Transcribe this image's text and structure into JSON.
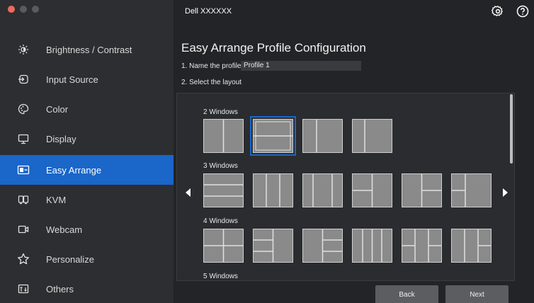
{
  "window": {
    "title": "Dell XXXXXX"
  },
  "sidebar": {
    "items": [
      {
        "label": "Brightness / Contrast",
        "icon": "brightness-icon",
        "active": false
      },
      {
        "label": "Input Source",
        "icon": "input-source-icon",
        "active": false
      },
      {
        "label": "Color",
        "icon": "color-palette-icon",
        "active": false
      },
      {
        "label": "Display",
        "icon": "display-icon",
        "active": false
      },
      {
        "label": "Easy Arrange",
        "icon": "easy-arrange-icon",
        "active": true
      },
      {
        "label": "KVM",
        "icon": "kvm-icon",
        "active": false
      },
      {
        "label": "Webcam",
        "icon": "webcam-icon",
        "active": false
      },
      {
        "label": "Personalize",
        "icon": "star-icon",
        "active": false
      },
      {
        "label": "Others",
        "icon": "others-icon",
        "active": false
      }
    ]
  },
  "main": {
    "page_title": "Easy Arrange Profile Configuration",
    "step1_label": "1. Name the profile",
    "profile_name": "Profile 1",
    "step2_label": "2. Select the layout",
    "groups": [
      {
        "label": "2 Windows",
        "layouts": [
          "2-vertical",
          "2-horizontal",
          "2-left-narrow",
          "2-left-narrow-b"
        ],
        "selected_index": 1
      },
      {
        "label": "3 Windows",
        "layouts": [
          "3-rows",
          "3-cols",
          "3-cols-wide-center",
          "3-left-split",
          "3-right-split",
          "3-left-split-b"
        ],
        "selected_index": -1
      },
      {
        "label": "4 Windows",
        "layouts": [
          "4-grid",
          "4-left-three",
          "4-right-three",
          "4-cols",
          "4-two-split",
          "4-right-split"
        ],
        "selected_index": -1
      },
      {
        "label": "5 Windows",
        "layouts": [],
        "selected_index": -1
      }
    ]
  },
  "buttons": {
    "back": "Back",
    "next": "Next"
  },
  "colors": {
    "accent": "#1a66c9",
    "sidebar_bg": "#2d2e31",
    "main_bg": "#232427",
    "tile_fill": "#8a8a8a"
  }
}
